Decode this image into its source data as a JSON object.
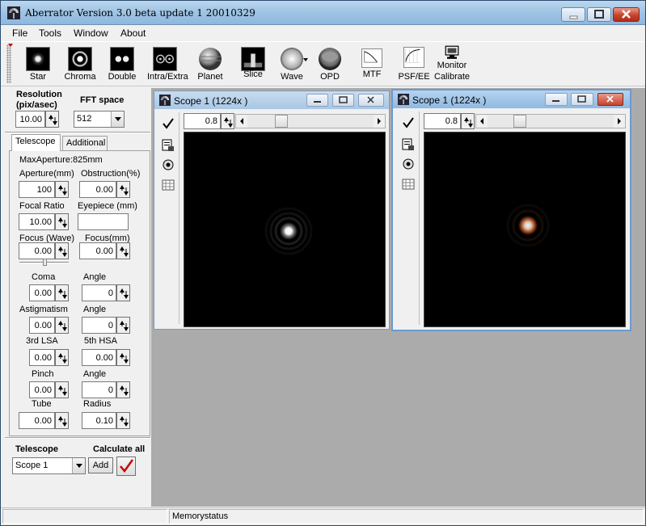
{
  "window": {
    "title": "Aberrator Version 3.0 beta update 1 20010329"
  },
  "menu": [
    "File",
    "Tools",
    "Window",
    "About"
  ],
  "toolbar": {
    "buttons": [
      {
        "label": "Star",
        "icon": "star-icon"
      },
      {
        "label": "Chroma",
        "icon": "chroma-icon"
      },
      {
        "label": "Double",
        "icon": "double-star-icon"
      },
      {
        "label": "Intra/Extra",
        "icon": "intra-extra-icon"
      },
      {
        "label": "Planet",
        "icon": "planet-icon"
      },
      {
        "label": "Slice",
        "icon": "slice-icon"
      },
      {
        "label": "Wave",
        "icon": "wave-icon"
      },
      {
        "label": "OPD",
        "icon": "opd-icon"
      },
      {
        "label": "MTF",
        "icon": "mtf-icon"
      },
      {
        "label": "PSF/EE",
        "icon": "psf-ee-icon"
      },
      {
        "label": "Monitor",
        "label2": "Calibrate",
        "icon": "monitor-icon"
      }
    ]
  },
  "settings": {
    "resolution_label": "Resolution",
    "resolution_unit": "(pix/asec)",
    "resolution_value": "10.00",
    "fft_label": "FFT space",
    "fft_value": "512"
  },
  "tabs": [
    "Telescope",
    "Additional"
  ],
  "telescope": {
    "max_aperture": "MaxAperture:825mm",
    "aperture_label": "Aperture(mm)",
    "aperture_value": "100",
    "obstruction_label": "Obstruction(%)",
    "obstruction_value": "0.00",
    "focal_ratio_label": "Focal Ratio",
    "focal_ratio_value": "10.00",
    "eyepiece_label": "Eyepiece (mm)",
    "eyepiece_value": "",
    "focus_wave_label": "Focus (Wave)",
    "focus_wave_value": "0.00",
    "focus_mm_label": "Focus(mm)",
    "focus_mm_value": "0.00",
    "coma_label": "Coma",
    "coma_value": "0.00",
    "coma_angle_label": "Angle",
    "coma_angle_value": "0",
    "astig_label": "Astigmatism",
    "astig_value": "0.00",
    "astig_angle_label": "Angle",
    "astig_angle_value": "0",
    "lsa3_label": "3rd LSA",
    "lsa3_value": "0.00",
    "hsa5_label": "5th HSA",
    "hsa5_value": "0.00",
    "pinch_label": "Pinch",
    "pinch_value": "0.00",
    "pinch_angle_label": "Angle",
    "pinch_angle_value": "0",
    "tube_label": "Tube",
    "tube_value": "0.00",
    "radius_label": "Radius",
    "radius_value": "0.10"
  },
  "bottom": {
    "telescope_label": "Telescope",
    "calculate_label": "Calculate all",
    "scope_value": "Scope 1",
    "add_label": "Add"
  },
  "scopes": [
    {
      "title": "Scope 1 (1224x )",
      "zoom": "0.8"
    },
    {
      "title": "Scope 1 (1224x )",
      "zoom": "0.8"
    }
  ],
  "status": {
    "memory": "Memorystatus"
  },
  "colors": {
    "titlebar": "#9ec3e4",
    "mdi": "#ababab",
    "check": "#cc0000"
  }
}
